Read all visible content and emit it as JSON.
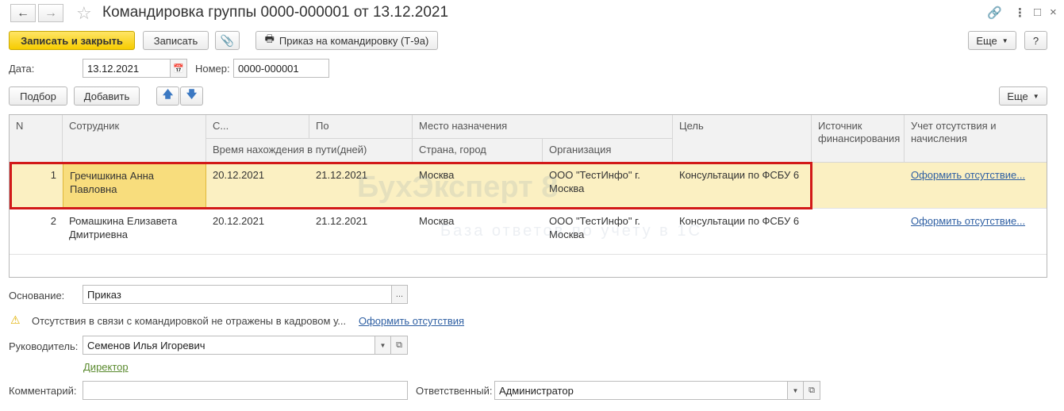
{
  "window": {
    "title": "Командировка группы 0000-000001 от 13.12.2021"
  },
  "toolbar": {
    "save_close": "Записать и закрыть",
    "save": "Записать",
    "print_order": "Приказ на командировку (Т-9а)",
    "more": "Еще",
    "help": "?"
  },
  "header": {
    "date_label": "Дата:",
    "date_value": "13.12.2021",
    "number_label": "Номер:",
    "number_value": "0000-000001"
  },
  "table_toolbar": {
    "select": "Подбор",
    "add": "Добавить",
    "more": "Еще"
  },
  "table": {
    "headers": {
      "n": "N",
      "employee": "Сотрудник",
      "from": "С...",
      "to": "По",
      "travel_days": "Время нахождения в пути(дней)",
      "destination": "Место назначения",
      "country_city": "Страна, город",
      "organization": "Организация",
      "purpose": "Цель",
      "funding": "Источник финансирования",
      "absence": "Учет отсутствия и начисления"
    },
    "rows": [
      {
        "n": "1",
        "employee": "Гречишкина Анна Павловна",
        "from": "20.12.2021",
        "to": "21.12.2021",
        "city": "Москва",
        "org": "ООО \"ТестИнфо\" г. Москва",
        "purpose": "Консультации по ФСБУ 6",
        "absence_link": "Оформить отсутствие..."
      },
      {
        "n": "2",
        "employee": "Ромашкина Елизавета Дмитриевна",
        "from": "20.12.2021",
        "to": "21.12.2021",
        "city": "Москва",
        "org": "ООО \"ТестИнфо\" г. Москва",
        "purpose": "Консультации по ФСБУ 6",
        "absence_link": "Оформить отсутствие..."
      }
    ]
  },
  "watermark": {
    "brand": "БухЭксперт 8",
    "tagline": "База ответов по учету в 1С"
  },
  "footer": {
    "basis_label": "Основание:",
    "basis_value": "Приказ",
    "warning_text": "Отсутствия в связи с командировкой не отражены в кадровом у...",
    "warning_link": "Оформить отсутствия",
    "manager_label": "Руководитель:",
    "manager_value": "Семенов Илья Игоревич",
    "manager_position": "Директор",
    "comment_label": "Комментарий:",
    "comment_value": "",
    "responsible_label": "Ответственный:",
    "responsible_value": "Администратор"
  }
}
